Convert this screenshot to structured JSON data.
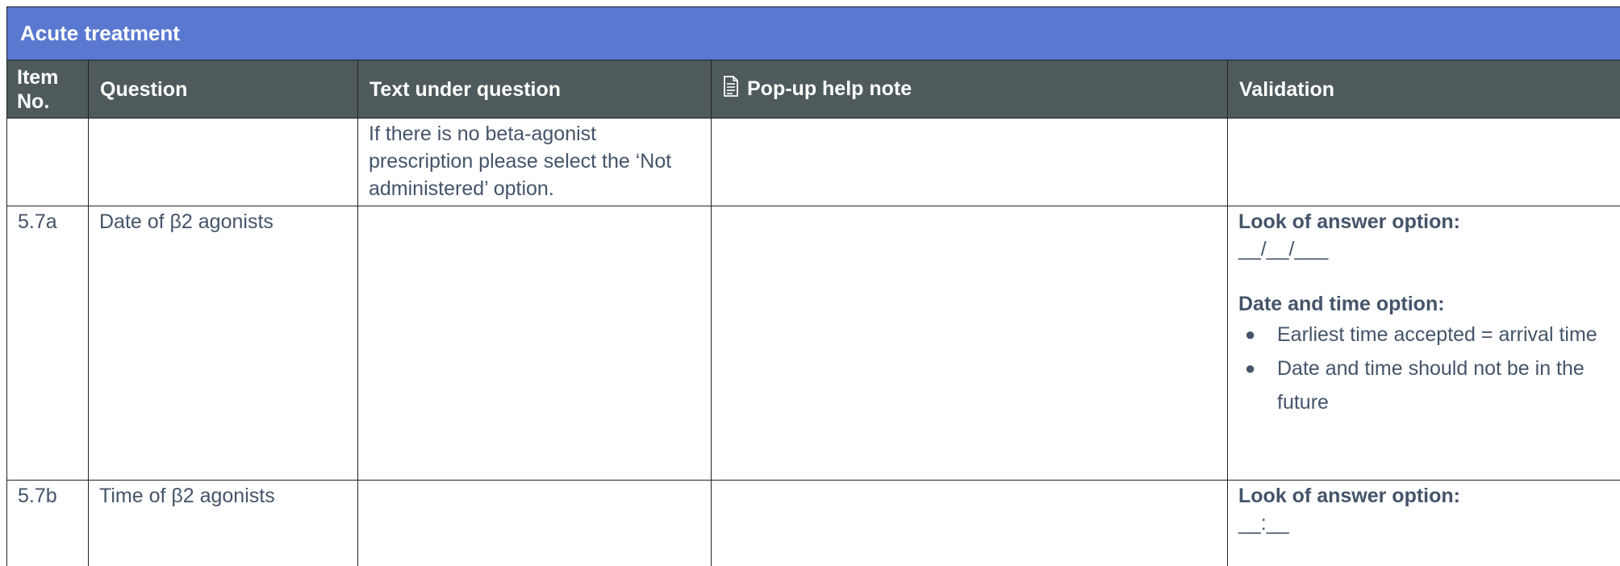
{
  "section_title": "Acute treatment",
  "headers": {
    "item_no": "Item No.",
    "question": "Question",
    "text_under_question": "Text under question",
    "popup_help_note": "Pop-up help note",
    "validation": "Validation"
  },
  "header_icons": {
    "popup_help_note": "document-icon"
  },
  "colors": {
    "title_bg": "#5a78d0",
    "header_bg": "#4e5a5c",
    "body_text": "#44546a"
  },
  "rows": [
    {
      "item_no": "",
      "question": "",
      "text_under_question": "If there is no beta-agonist prescription please select the ‘Not administered’ option.",
      "popup_help_note": ""
    },
    {
      "item_no": "5.7a",
      "question": "Date of β2 agonists",
      "text_under_question": "",
      "popup_help_note": "",
      "validation": {
        "look_heading": "Look of answer option:",
        "look_value": "__/__/___",
        "date_time_heading": "Date and time option:",
        "bullets": [
          "Earliest time accepted = arrival time",
          "Date and time should not be in the future"
        ]
      }
    },
    {
      "item_no": "5.7b",
      "question": "Time of β2 agonists",
      "text_under_question": "",
      "popup_help_note": "",
      "validation": {
        "look_heading": "Look of answer option:",
        "look_value": "__:__"
      }
    }
  ]
}
